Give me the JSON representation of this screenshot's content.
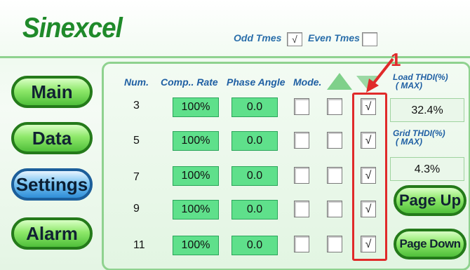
{
  "header": {
    "logo": "Sinexcel",
    "odd_label": "Odd Tmes",
    "odd_checked": "√",
    "even_label": "Even Tmes",
    "even_checked": ""
  },
  "nav": {
    "main": "Main",
    "data": "Data",
    "settings": "Settings",
    "alarm": "Alarm",
    "active": "Settings"
  },
  "table": {
    "headers": [
      "Num.",
      "Comp.. Rate",
      "Phase Angle",
      "Mode."
    ],
    "rows": [
      {
        "num": "3",
        "rate": "100%",
        "angle": "0.0",
        "mode": [
          "",
          "",
          "√"
        ]
      },
      {
        "num": "5",
        "rate": "100%",
        "angle": "0.0",
        "mode": [
          "",
          "",
          "√"
        ]
      },
      {
        "num": "7",
        "rate": "100%",
        "angle": "0.0",
        "mode": [
          "",
          "",
          "√"
        ]
      },
      {
        "num": "9",
        "rate": "100%",
        "angle": "0.0",
        "mode": [
          "",
          "",
          "√"
        ]
      },
      {
        "num": "11",
        "rate": "100%",
        "angle": "0.0",
        "mode": [
          "",
          "",
          "√"
        ]
      }
    ]
  },
  "side": {
    "load_label_1": "Load THDI(%)",
    "load_label_2": "( MAX)",
    "load_value": "32.4%",
    "grid_label_1": "Grid THDI(%)",
    "grid_label_2": "( MAX)",
    "grid_value": "4.3%",
    "page_up": "Page Up",
    "page_down": "Page Down"
  },
  "annotation": {
    "number": "1",
    "color": "#e02a2a"
  },
  "icons": [
    "scroll-up-icon",
    "scroll-down-icon",
    "annotation-arrow-icon"
  ]
}
